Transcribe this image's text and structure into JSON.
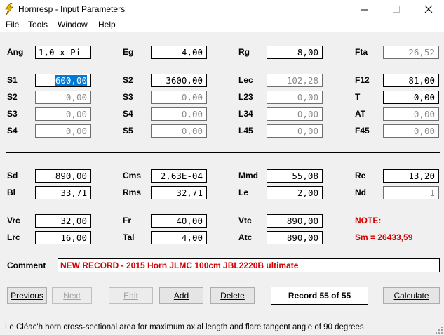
{
  "window": {
    "title": "Hornresp - Input Parameters",
    "minimize": "—",
    "maximize": "☐",
    "close": "✕"
  },
  "menu": [
    "File",
    "Tools",
    "Window",
    "Help"
  ],
  "params": {
    "ang": {
      "label": "Ang",
      "value": "1,0 x Pi"
    },
    "eg": {
      "label": "Eg",
      "value": "4,00"
    },
    "rg": {
      "label": "Rg",
      "value": "8,00"
    },
    "fta": {
      "label": "Fta",
      "value": "26,52"
    },
    "s1": {
      "label": "S1",
      "value": "600,00"
    },
    "s2a": {
      "label": "S2",
      "value": "3600,00"
    },
    "lec": {
      "label": "Lec",
      "value": "102,28"
    },
    "f12": {
      "label": "F12",
      "value": "81,00"
    },
    "s2b": {
      "label": "S2",
      "value": "0,00"
    },
    "s3a": {
      "label": "S3",
      "value": "0,00"
    },
    "l23": {
      "label": "L23",
      "value": "0,00"
    },
    "t": {
      "label": "T",
      "value": "0,00"
    },
    "s3b": {
      "label": "S3",
      "value": "0,00"
    },
    "s4a": {
      "label": "S4",
      "value": "0,00"
    },
    "l34": {
      "label": "L34",
      "value": "0,00"
    },
    "at": {
      "label": "AT",
      "value": "0,00"
    },
    "s4b": {
      "label": "S4",
      "value": "0,00"
    },
    "s5": {
      "label": "S5",
      "value": "0,00"
    },
    "l45": {
      "label": "L45",
      "value": "0,00"
    },
    "f45": {
      "label": "F45",
      "value": "0,00"
    },
    "sd": {
      "label": "Sd",
      "value": "890,00"
    },
    "cms": {
      "label": "Cms",
      "value": "2,63E-04"
    },
    "mmd": {
      "label": "Mmd",
      "value": "55,08"
    },
    "re": {
      "label": "Re",
      "value": "13,20"
    },
    "bl": {
      "label": "Bl",
      "value": "33,71"
    },
    "rms": {
      "label": "Rms",
      "value": "32,71"
    },
    "le": {
      "label": "Le",
      "value": "2,00"
    },
    "nd": {
      "label": "Nd",
      "value": "1"
    },
    "vrc": {
      "label": "Vrc",
      "value": "32,00"
    },
    "fr": {
      "label": "Fr",
      "value": "40,00"
    },
    "vtc": {
      "label": "Vtc",
      "value": "890,00"
    },
    "lrc": {
      "label": "Lrc",
      "value": "16,00"
    },
    "tal": {
      "label": "Tal",
      "value": "4,00"
    },
    "atc": {
      "label": "Atc",
      "value": "890,00"
    }
  },
  "note": {
    "title": "NOTE:",
    "text": "Sm = 26433,59"
  },
  "comment": {
    "label": "Comment",
    "value": "NEW RECORD - 2015 Horn JLMC 100cm JBL2220B ultimate"
  },
  "buttons": {
    "previous": "Previous",
    "next": "Next",
    "edit": "Edit",
    "add": "Add",
    "delete": "Delete",
    "calculate": "Calculate"
  },
  "record": "Record 55 of 55",
  "status": "Le Cléac'h horn cross-sectional area for maximum axial length and flare tangent angle of 90 degrees",
  "colors": {
    "note": "#d40000",
    "selection": "#0078d7",
    "icon": "#f0c000"
  }
}
